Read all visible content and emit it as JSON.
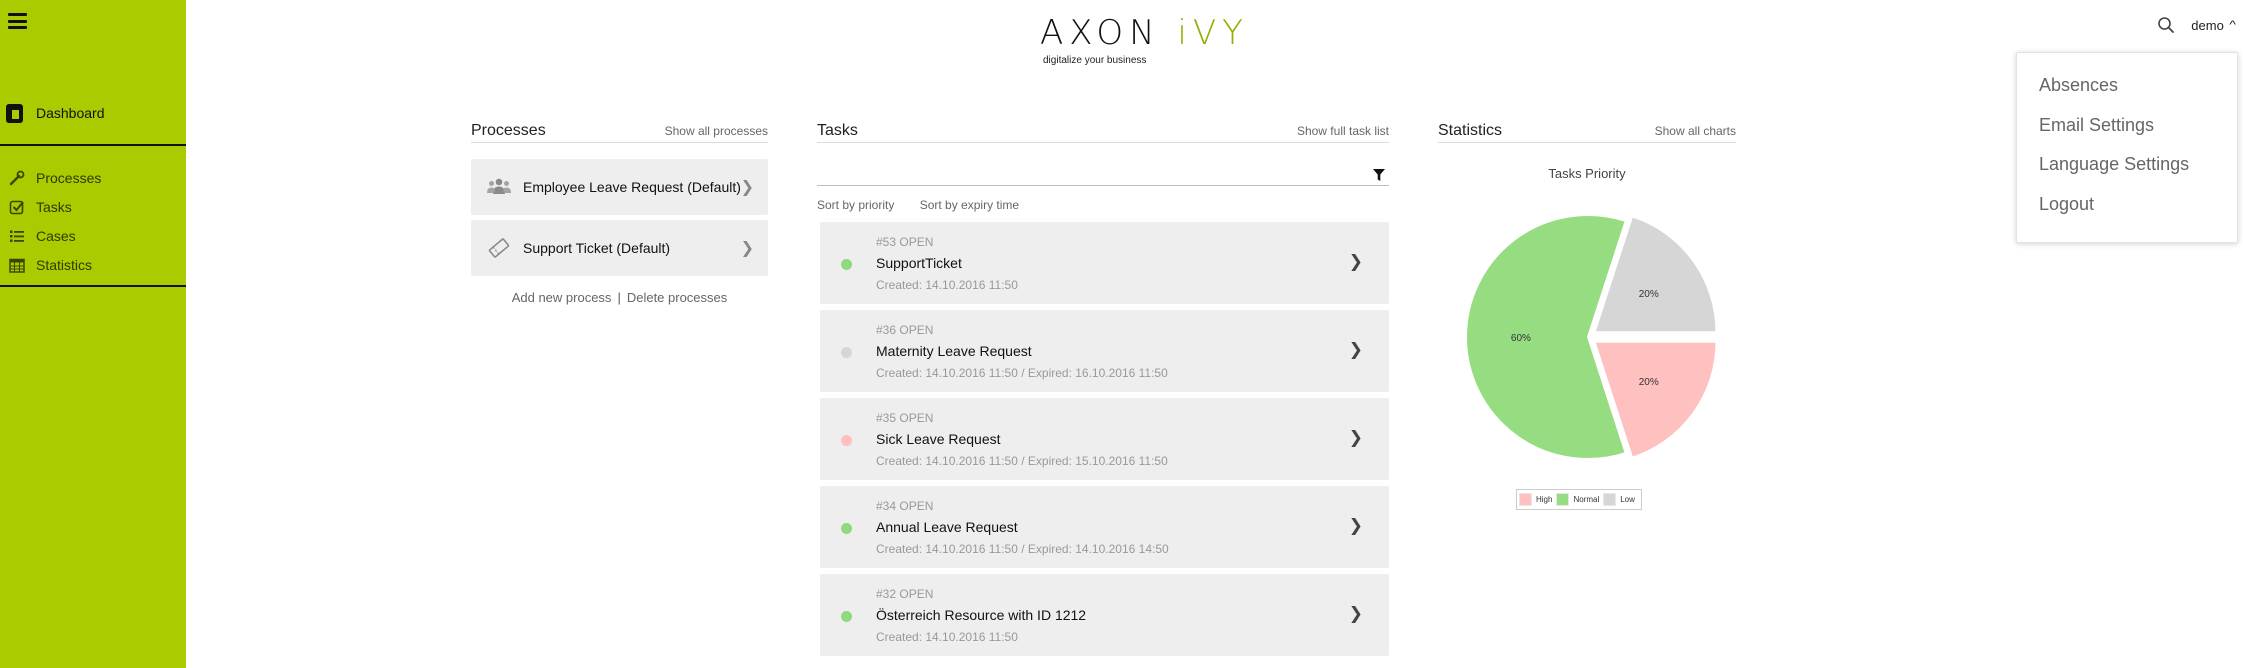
{
  "sidebar": {
    "dashboard_label": "Dashboard",
    "items": [
      {
        "label": "Processes",
        "icon": "wrench-icon"
      },
      {
        "label": "Tasks",
        "icon": "check-square-icon"
      },
      {
        "label": "Cases",
        "icon": "list-icon"
      },
      {
        "label": "Statistics",
        "icon": "calendar-icon"
      }
    ]
  },
  "logo": {
    "word_a": "AXON ",
    "word_b": "iVY",
    "tagline": "digitalize your business"
  },
  "header": {
    "user": "demo"
  },
  "user_menu": [
    "Absences",
    "Email Settings",
    "Language Settings",
    "Logout"
  ],
  "processes": {
    "title": "Processes",
    "show_all": "Show all processes",
    "items": [
      {
        "label": "Employee Leave Request (Default)",
        "icon": "users-icon"
      },
      {
        "label": "Support Ticket (Default)",
        "icon": "ticket-icon"
      }
    ],
    "add_new": "Add new process",
    "separator": "|",
    "delete": "Delete processes"
  },
  "tasks": {
    "title": "Tasks",
    "show_full": "Show full task list",
    "sort_priority": "Sort by priority",
    "sort_expiry": "Sort by expiry time",
    "items": [
      {
        "id": "#53 OPEN",
        "name": "SupportTicket",
        "date": "Created: 14.10.2016 11:50",
        "priority_color": "#8fd97e"
      },
      {
        "id": "#36 OPEN",
        "name": "Maternity Leave Request",
        "date": "Created: 14.10.2016 11:50 / Expired: 16.10.2016 11:50",
        "priority_color": "#d6d6d6"
      },
      {
        "id": "#35 OPEN",
        "name": "Sick Leave Request",
        "date": "Created: 14.10.2016 11:50 / Expired: 15.10.2016 11:50",
        "priority_color": "#ffc0c0"
      },
      {
        "id": "#34 OPEN",
        "name": "Annual Leave Request",
        "date": "Created: 14.10.2016 11:50 / Expired: 14.10.2016 14:50",
        "priority_color": "#8fd97e"
      },
      {
        "id": "#32 OPEN",
        "name": "Österreich Resource with ID 1212",
        "date": "Created: 14.10.2016 11:50",
        "priority_color": "#8fd97e"
      }
    ]
  },
  "statistics": {
    "title": "Statistics",
    "show_all": "Show all charts"
  },
  "chart_data": {
    "type": "pie",
    "title": "Tasks Priority",
    "categories": [
      "High",
      "Normal",
      "Low"
    ],
    "values": [
      20,
      60,
      20
    ],
    "labels": [
      "20%",
      "60%",
      "20%"
    ],
    "colors": [
      "#ffc0c0",
      "#96dc80",
      "#d6d6d6"
    ],
    "legend": "bottom"
  }
}
